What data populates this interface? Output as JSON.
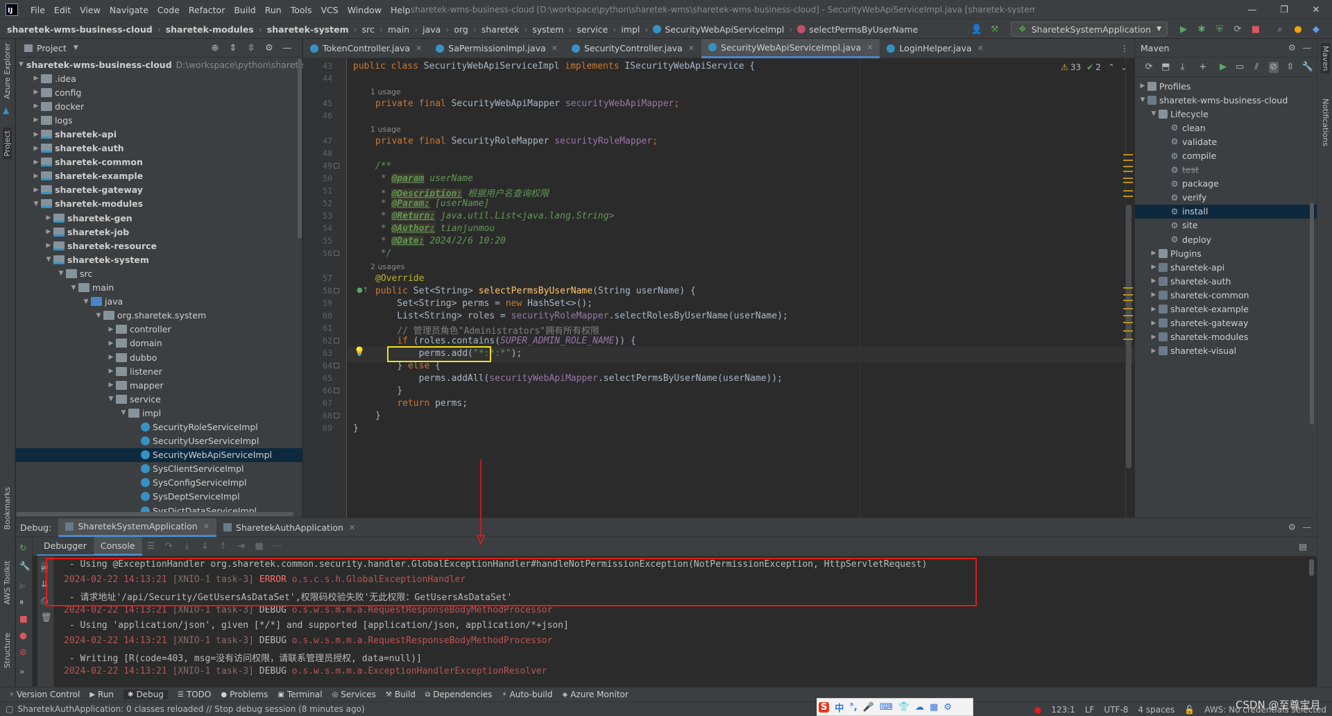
{
  "titlebar": {
    "menu": [
      "File",
      "Edit",
      "View",
      "Navigate",
      "Code",
      "Refactor",
      "Build",
      "Run",
      "Tools",
      "VCS",
      "Window",
      "Help"
    ],
    "window_title": "sharetek-wms-business-cloud [D:\\workspace\\python\\sharetek-wms\\sharetek-wms-business-cloud] - SecurityWebApiServiceImpl.java [sharetek-system]"
  },
  "navbar": {
    "breadcrumbs": [
      "sharetek-wms-business-cloud",
      "sharetek-modules",
      "sharetek-system",
      "src",
      "main",
      "java",
      "org",
      "sharetek",
      "system",
      "service",
      "impl",
      "SecurityWebApiServiceImpl",
      "selectPermsByUserName"
    ],
    "run_config": "SharetekSystemApplication"
  },
  "left_stripe": [
    "Azure Explorer",
    "Project",
    "Bookmarks",
    "AWS Toolkit",
    "Structure"
  ],
  "right_stripe": [
    "Maven",
    "Notifications"
  ],
  "project": {
    "title": "Project",
    "tree": [
      {
        "label": "sharetek-wms-business-cloud",
        "hint": "D:\\workspace\\python\\sharetek",
        "depth": 0,
        "arrow": "open",
        "icon": "modfolder",
        "bold": true
      },
      {
        "label": ".idea",
        "depth": 1,
        "arrow": "closed",
        "icon": "folder"
      },
      {
        "label": "config",
        "depth": 1,
        "arrow": "closed",
        "icon": "folder"
      },
      {
        "label": "docker",
        "depth": 1,
        "arrow": "closed",
        "icon": "folder"
      },
      {
        "label": "logs",
        "depth": 1,
        "arrow": "closed",
        "icon": "folder"
      },
      {
        "label": "sharetek-api",
        "depth": 1,
        "arrow": "closed",
        "icon": "modfolder",
        "bold": true
      },
      {
        "label": "sharetek-auth",
        "depth": 1,
        "arrow": "closed",
        "icon": "modfolder",
        "bold": true
      },
      {
        "label": "sharetek-common",
        "depth": 1,
        "arrow": "closed",
        "icon": "modfolder",
        "bold": true
      },
      {
        "label": "sharetek-example",
        "depth": 1,
        "arrow": "closed",
        "icon": "modfolder",
        "bold": true
      },
      {
        "label": "sharetek-gateway",
        "depth": 1,
        "arrow": "closed",
        "icon": "modfolder",
        "bold": true
      },
      {
        "label": "sharetek-modules",
        "depth": 1,
        "arrow": "open",
        "icon": "modfolder",
        "bold": true
      },
      {
        "label": "sharetek-gen",
        "depth": 2,
        "arrow": "closed",
        "icon": "modfolder",
        "bold": true
      },
      {
        "label": "sharetek-job",
        "depth": 2,
        "arrow": "closed",
        "icon": "modfolder",
        "bold": true
      },
      {
        "label": "sharetek-resource",
        "depth": 2,
        "arrow": "closed",
        "icon": "modfolder",
        "bold": true
      },
      {
        "label": "sharetek-system",
        "depth": 2,
        "arrow": "open",
        "icon": "modfolder",
        "bold": true
      },
      {
        "label": "src",
        "depth": 3,
        "arrow": "open",
        "icon": "folder"
      },
      {
        "label": "main",
        "depth": 4,
        "arrow": "open",
        "icon": "folder"
      },
      {
        "label": "java",
        "depth": 5,
        "arrow": "open",
        "icon": "srcfolder"
      },
      {
        "label": "org.sharetek.system",
        "depth": 6,
        "arrow": "open",
        "icon": "folder"
      },
      {
        "label": "controller",
        "depth": 7,
        "arrow": "closed",
        "icon": "folder"
      },
      {
        "label": "domain",
        "depth": 7,
        "arrow": "closed",
        "icon": "folder"
      },
      {
        "label": "dubbo",
        "depth": 7,
        "arrow": "closed",
        "icon": "folder"
      },
      {
        "label": "listener",
        "depth": 7,
        "arrow": "closed",
        "icon": "folder"
      },
      {
        "label": "mapper",
        "depth": 7,
        "arrow": "closed",
        "icon": "folder"
      },
      {
        "label": "service",
        "depth": 7,
        "arrow": "open",
        "icon": "folder"
      },
      {
        "label": "impl",
        "depth": 8,
        "arrow": "open",
        "icon": "folder"
      },
      {
        "label": "SecurityRoleServiceImpl",
        "depth": 9,
        "arrow": "none",
        "icon": "cls"
      },
      {
        "label": "SecurityUserServiceImpl",
        "depth": 9,
        "arrow": "none",
        "icon": "cls"
      },
      {
        "label": "SecurityWebApiServiceImpl",
        "depth": 9,
        "arrow": "none",
        "icon": "cls",
        "selected": true
      },
      {
        "label": "SysClientServiceImpl",
        "depth": 9,
        "arrow": "none",
        "icon": "cls"
      },
      {
        "label": "SysConfigServiceImpl",
        "depth": 9,
        "arrow": "none",
        "icon": "cls"
      },
      {
        "label": "SysDeptServiceImpl",
        "depth": 9,
        "arrow": "none",
        "icon": "cls"
      },
      {
        "label": "SysDictDataServiceImpl",
        "depth": 9,
        "arrow": "none",
        "icon": "cls"
      }
    ]
  },
  "editor": {
    "tabs": [
      "TokenController.java",
      "SaPermissionImpl.java",
      "SecurityController.java",
      "SecurityWebApiServiceImpl.java",
      "LoginHelper.java"
    ],
    "active_tab": 3,
    "inspections": {
      "warnings": "33",
      "ok": "2"
    },
    "line_numbers": [
      "43",
      "44",
      "45",
      "46",
      "47",
      "48",
      "49",
      "50",
      "51",
      "52",
      "53",
      "54",
      "55",
      "56",
      "57",
      "58",
      "59",
      "60",
      "61",
      "62",
      "63",
      "64",
      "65",
      "66",
      "67",
      "68",
      "69"
    ],
    "usages": {
      "u45": "1 usage",
      "u47": "1 usage",
      "u57": "2 usages"
    },
    "code": {
      "l43_a": "public class ",
      "l43_b": "SecurityWebApiServiceImpl ",
      "l43_c": "implements ",
      "l43_d": "ISecurityWebApiService {",
      "l45_a": "private final ",
      "l45_b": "SecurityWebApiMapper ",
      "l45_c": "securityWebApiMapper",
      "l45_d": ";",
      "l47_a": "private final ",
      "l47_b": "SecurityRoleMapper ",
      "l47_c": "securityRoleMapper",
      "l47_d": ";",
      "l49": "/**",
      "l50_a": " * ",
      "l50_b": "@param",
      "l50_c": " ",
      "l50_d": "userName",
      "l51_a": " * ",
      "l51_b": "@Description:",
      "l51_c": " 根据用户名查询权限",
      "l52_a": " * ",
      "l52_b": "@Param:",
      "l52_c": " [userName]",
      "l53_a": " * ",
      "l53_b": "@Return:",
      "l53_c": " java.util.List<java.lang.String>",
      "l54_a": " * ",
      "l54_b": "@Author:",
      "l54_c": " tianjunmou",
      "l55_a": " * ",
      "l55_b": "@Date:",
      "l55_c": " 2024/2/6 10:20",
      "l56": " */",
      "l57": "@Override",
      "l58_a": "public ",
      "l58_b": "Set<String> ",
      "l58_c": "selectPermsByUserName",
      "l58_d": "(String userName) {",
      "l59_a": "    Set<String> perms = ",
      "l59_b": "new ",
      "l59_c": "HashSet<>();",
      "l60_a": "    List<String> roles = ",
      "l60_b": "securityRoleMapper",
      "l60_c": ".selectRolesByUserName(userName);",
      "l61": "    // 管理员角色\"Administrators\"拥有所有权限",
      "l62_a": "    ",
      "l62_b": "if ",
      "l62_c": "(roles.contains(",
      "l62_d": "SUPER_ADMIN_ROLE_NAME",
      "l62_e": ")) {",
      "l63_a": "        perms.add(",
      "l63_b": "\"*:*:*\"",
      "l63_c": ");",
      "l64_a": "    } ",
      "l64_b": "else ",
      "l64_c": "{",
      "l65_a": "        perms.addAll(",
      "l65_b": "securityWebApiMapper",
      "l65_c": ".selectPermsByUserName(userName));",
      "l66": "    }",
      "l67_a": "    ",
      "l67_b": "return ",
      "l67_c": "perms;",
      "l68": "}",
      "l69": "}"
    }
  },
  "maven": {
    "title": "Maven",
    "tree": [
      {
        "label": "Profiles",
        "depth": 0,
        "arrow": "closed",
        "kind": "folder"
      },
      {
        "label": "sharetek-wms-business-cloud",
        "depth": 0,
        "arrow": "open",
        "kind": "mvn"
      },
      {
        "label": "Lifecycle",
        "depth": 1,
        "arrow": "open",
        "kind": "folder"
      },
      {
        "label": "clean",
        "depth": 2,
        "arrow": "none",
        "kind": "gear"
      },
      {
        "label": "validate",
        "depth": 2,
        "arrow": "none",
        "kind": "gear"
      },
      {
        "label": "compile",
        "depth": 2,
        "arrow": "none",
        "kind": "gear"
      },
      {
        "label": "test",
        "depth": 2,
        "arrow": "none",
        "kind": "gear",
        "struck": true
      },
      {
        "label": "package",
        "depth": 2,
        "arrow": "none",
        "kind": "gear"
      },
      {
        "label": "verify",
        "depth": 2,
        "arrow": "none",
        "kind": "gear"
      },
      {
        "label": "install",
        "depth": 2,
        "arrow": "none",
        "kind": "gear",
        "selected": true
      },
      {
        "label": "site",
        "depth": 2,
        "arrow": "none",
        "kind": "gear"
      },
      {
        "label": "deploy",
        "depth": 2,
        "arrow": "none",
        "kind": "gear"
      },
      {
        "label": "Plugins",
        "depth": 1,
        "arrow": "closed",
        "kind": "folder"
      },
      {
        "label": "sharetek-api",
        "depth": 1,
        "arrow": "closed",
        "kind": "mvn"
      },
      {
        "label": "sharetek-auth",
        "depth": 1,
        "arrow": "closed",
        "kind": "mvn"
      },
      {
        "label": "sharetek-common",
        "depth": 1,
        "arrow": "closed",
        "kind": "mvn"
      },
      {
        "label": "sharetek-example",
        "depth": 1,
        "arrow": "closed",
        "kind": "mvn"
      },
      {
        "label": "sharetek-gateway",
        "depth": 1,
        "arrow": "closed",
        "kind": "mvn"
      },
      {
        "label": "sharetek-modules",
        "depth": 1,
        "arrow": "closed",
        "kind": "mvn"
      },
      {
        "label": "sharetek-visual",
        "depth": 1,
        "arrow": "closed",
        "kind": "mvn"
      }
    ]
  },
  "debug": {
    "label": "Debug:",
    "sessions": [
      "SharetekSystemApplication",
      "SharetekAuthApplication"
    ],
    "subtabs": [
      "Debugger",
      "Console"
    ],
    "console": {
      "l1": " - Using @ExceptionHandler org.sharetek.common.security.handler.GlobalExceptionHandler#handleNotPermissionException(NotPermissionException, HttpServletRequest)",
      "l2_ts": "2024-02-22 14:13:21 ",
      "l2_th": "[XNIO-1 task-3] ",
      "l2_lv": "ERROR ",
      "l2_cn": "o.s.c.s.h.GlobalExceptionHandler",
      "l3": " - 请求地址'/api/Security/GetUsersAsDataSet',权限码校验失败'无此权限：GetUsersAsDataSet'",
      "l4_ts": "2024-02-22 14:13:21 ",
      "l4_th": "[XNIO-1 task-3] ",
      "l4_lv": "DEBUG ",
      "l4_cn": "o.s.w.s.m.m.a.RequestResponseBodyMethodProcessor",
      "l5": " - Using 'application/json', given [*/*] and supported [application/json, application/*+json]",
      "l6_ts": "2024-02-22 14:13:21 ",
      "l6_th": "[XNIO-1 task-3] ",
      "l6_lv": "DEBUG ",
      "l6_cn": "o.s.w.s.m.m.a.RequestResponseBodyMethodProcessor",
      "l7": " - Writing [R(code=403, msg=没有访问权限，请联系管理员授权, data=null)]",
      "l8_ts": "2024-02-22 14:13:21 ",
      "l8_th": "[XNIO-1 task-3] ",
      "l8_lv": "DEBUG ",
      "l8_cn": "o.s.w.s.m.m.a.ExceptionHandlerExceptionResolver"
    }
  },
  "tool_windows": [
    "Version Control",
    "Run",
    "Debug",
    "TODO",
    "Problems",
    "Terminal",
    "Services",
    "Build",
    "Dependencies",
    "Auto-build",
    "Azure Monitor"
  ],
  "status": {
    "message": "SharetekAuthApplication: 0 classes reloaded // Stop debug session (8 minutes ago)",
    "position": "123:1",
    "line_sep": "LF",
    "encoding": "UTF-8",
    "indent": "4 spaces",
    "aws": "AWS: No credentials selected"
  },
  "ime": {
    "label": "中"
  },
  "watermark": "CSDN @至尊宝月",
  "colors": {
    "accent": "#4a88c7",
    "highlight_box": "#f0e020",
    "annotation_box": "#e21b1b",
    "selection": "#0d293e"
  }
}
